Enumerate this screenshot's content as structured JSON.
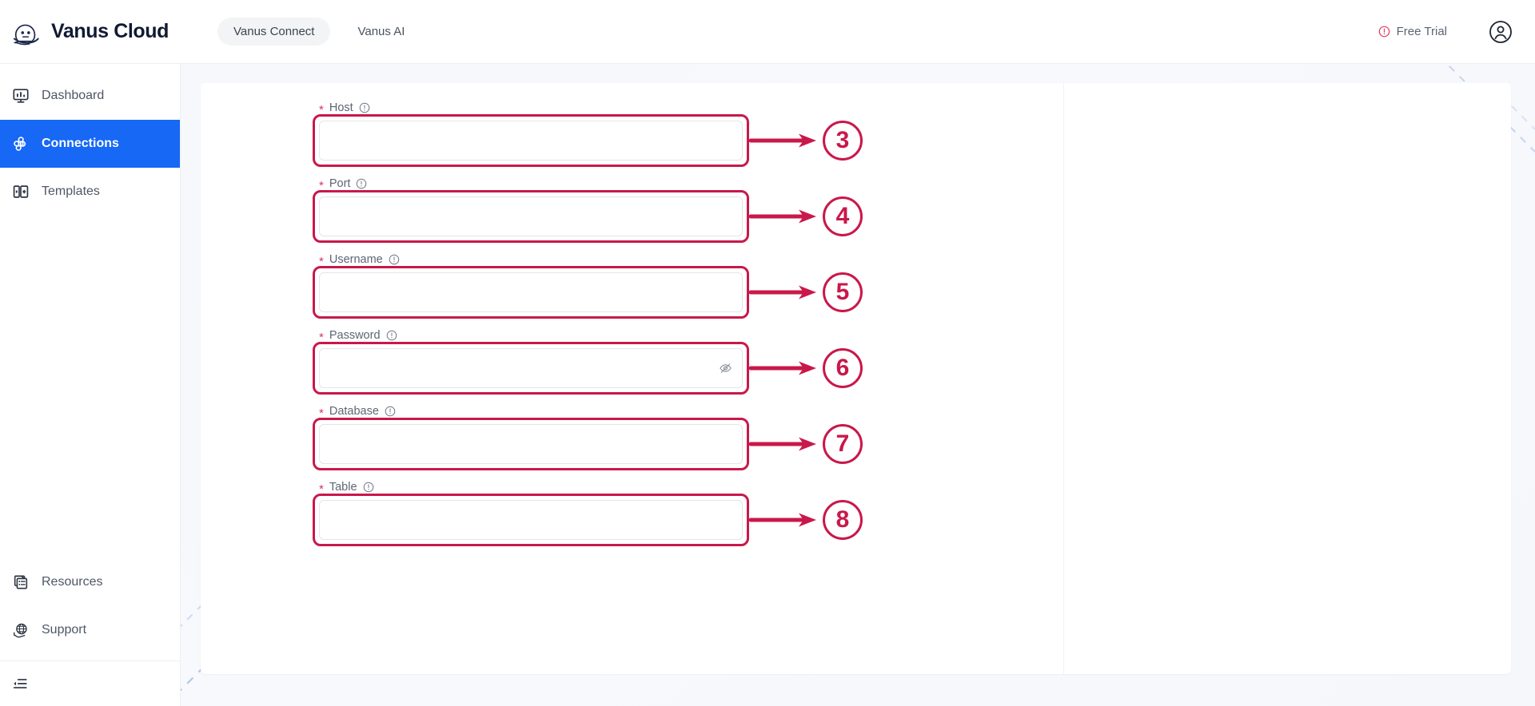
{
  "header": {
    "brand_name": "Vanus Cloud",
    "brand_logo_icon": "whale-logo-icon",
    "tabs": [
      {
        "label": "Vanus Connect",
        "active": true
      },
      {
        "label": "Vanus AI",
        "active": false
      }
    ],
    "free_trial": {
      "label": "Free Trial",
      "icon": "alert-circle-icon",
      "icon_color": "#e03a63"
    },
    "avatar_icon": "user-circle-icon"
  },
  "sidebar": {
    "active_color": "#1668f5",
    "items": [
      {
        "label": "Dashboard",
        "icon": "dashboard-monitor-icon",
        "active": false
      },
      {
        "label": "Connections",
        "icon": "connections-plug-icon",
        "active": true
      },
      {
        "label": "Templates",
        "icon": "templates-panels-icon",
        "active": false
      }
    ],
    "bottom_items": [
      {
        "label": "Resources",
        "icon": "resources-list-icon"
      },
      {
        "label": "Support",
        "icon": "support-globe-hand-icon"
      }
    ],
    "collapse_icon": "collapse-sidebar-icon"
  },
  "form": {
    "fields": [
      {
        "label": "Host",
        "required_marker": "*",
        "info_icon": "info-circle-icon",
        "value": "",
        "placeholder": "",
        "type": "text",
        "annotation": "3"
      },
      {
        "label": "Port",
        "required_marker": "*",
        "info_icon": "info-circle-icon",
        "value": "",
        "placeholder": "",
        "type": "text",
        "annotation": "4"
      },
      {
        "label": "Username",
        "required_marker": "*",
        "info_icon": "info-circle-icon",
        "value": "",
        "placeholder": "",
        "type": "text",
        "annotation": "5"
      },
      {
        "label": "Password",
        "required_marker": "*",
        "info_icon": "info-circle-icon",
        "value": "",
        "placeholder": "",
        "type": "password",
        "reveal_icon": "eye-off-icon",
        "annotation": "6"
      },
      {
        "label": "Database",
        "required_marker": "*",
        "info_icon": "info-circle-icon",
        "value": "",
        "placeholder": "",
        "type": "text",
        "annotation": "7"
      },
      {
        "label": "Table",
        "required_marker": "*",
        "info_icon": "info-circle-icon",
        "value": "",
        "placeholder": "",
        "type": "text",
        "annotation": "8"
      }
    ]
  },
  "annotation_style": {
    "color": "#c9184a",
    "shape": "rounded-rectangle-with-arrow-and-numbered-circle"
  }
}
